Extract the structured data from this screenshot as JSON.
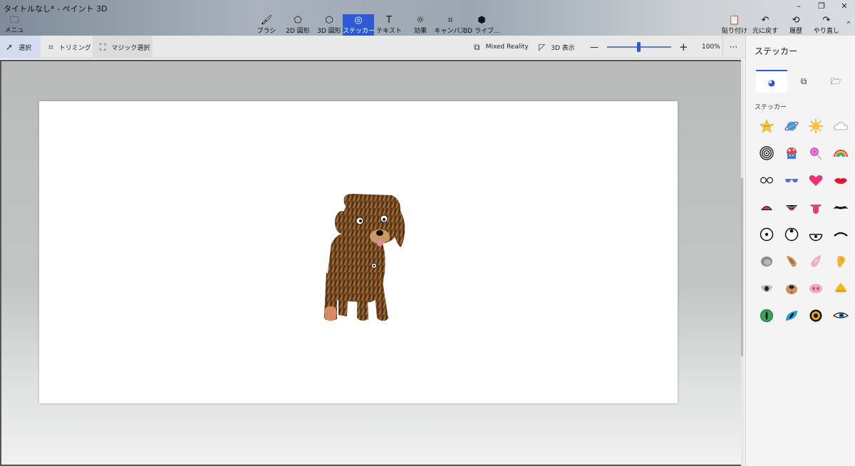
{
  "window": {
    "title": "タイトルなし* - ペイント 3D",
    "controls": [
      "–",
      "❐",
      "✕"
    ]
  },
  "menu": {
    "label": "メニュー"
  },
  "tools": [
    {
      "label": "ブラシ",
      "icon": "brush-icon"
    },
    {
      "label": "2D 図形",
      "icon": "2d-shapes-icon"
    },
    {
      "label": "3D 図形",
      "icon": "3d-shapes-icon"
    },
    {
      "label": "ステッカー",
      "icon": "stickers-icon",
      "active": true
    },
    {
      "label": "テキスト",
      "icon": "text-icon"
    },
    {
      "label": "効果",
      "icon": "effects-icon"
    },
    {
      "label": "キャンバス",
      "icon": "canvas-icon"
    },
    {
      "label": "3D ライブ...",
      "icon": "3d-library-icon"
    }
  ],
  "right_tools": [
    {
      "label": "貼り付け",
      "icon": "paste-icon"
    },
    {
      "label": "元に戻す",
      "icon": "undo-icon"
    },
    {
      "label": "履歴",
      "icon": "history-icon"
    },
    {
      "label": "やり直し",
      "icon": "redo-icon"
    }
  ],
  "toolbar": {
    "select": "選択",
    "crop": "トリミング",
    "magic_select": "マジック選択",
    "mixed_reality": "Mixed Reality",
    "view_3d": "3D 表示",
    "zoom_out": "—",
    "zoom_in": "+",
    "zoom_level": "100%",
    "more": "···"
  },
  "panel": {
    "title": "ステッカー",
    "section": "ステッカー",
    "tabs": [
      "stickers-tab-icon",
      "textures-tab-icon",
      "folder-icon"
    ]
  },
  "colors": {
    "accent": "#2e5bd3",
    "canvas": "#ffffff",
    "workspace": "#c3c5c4"
  }
}
